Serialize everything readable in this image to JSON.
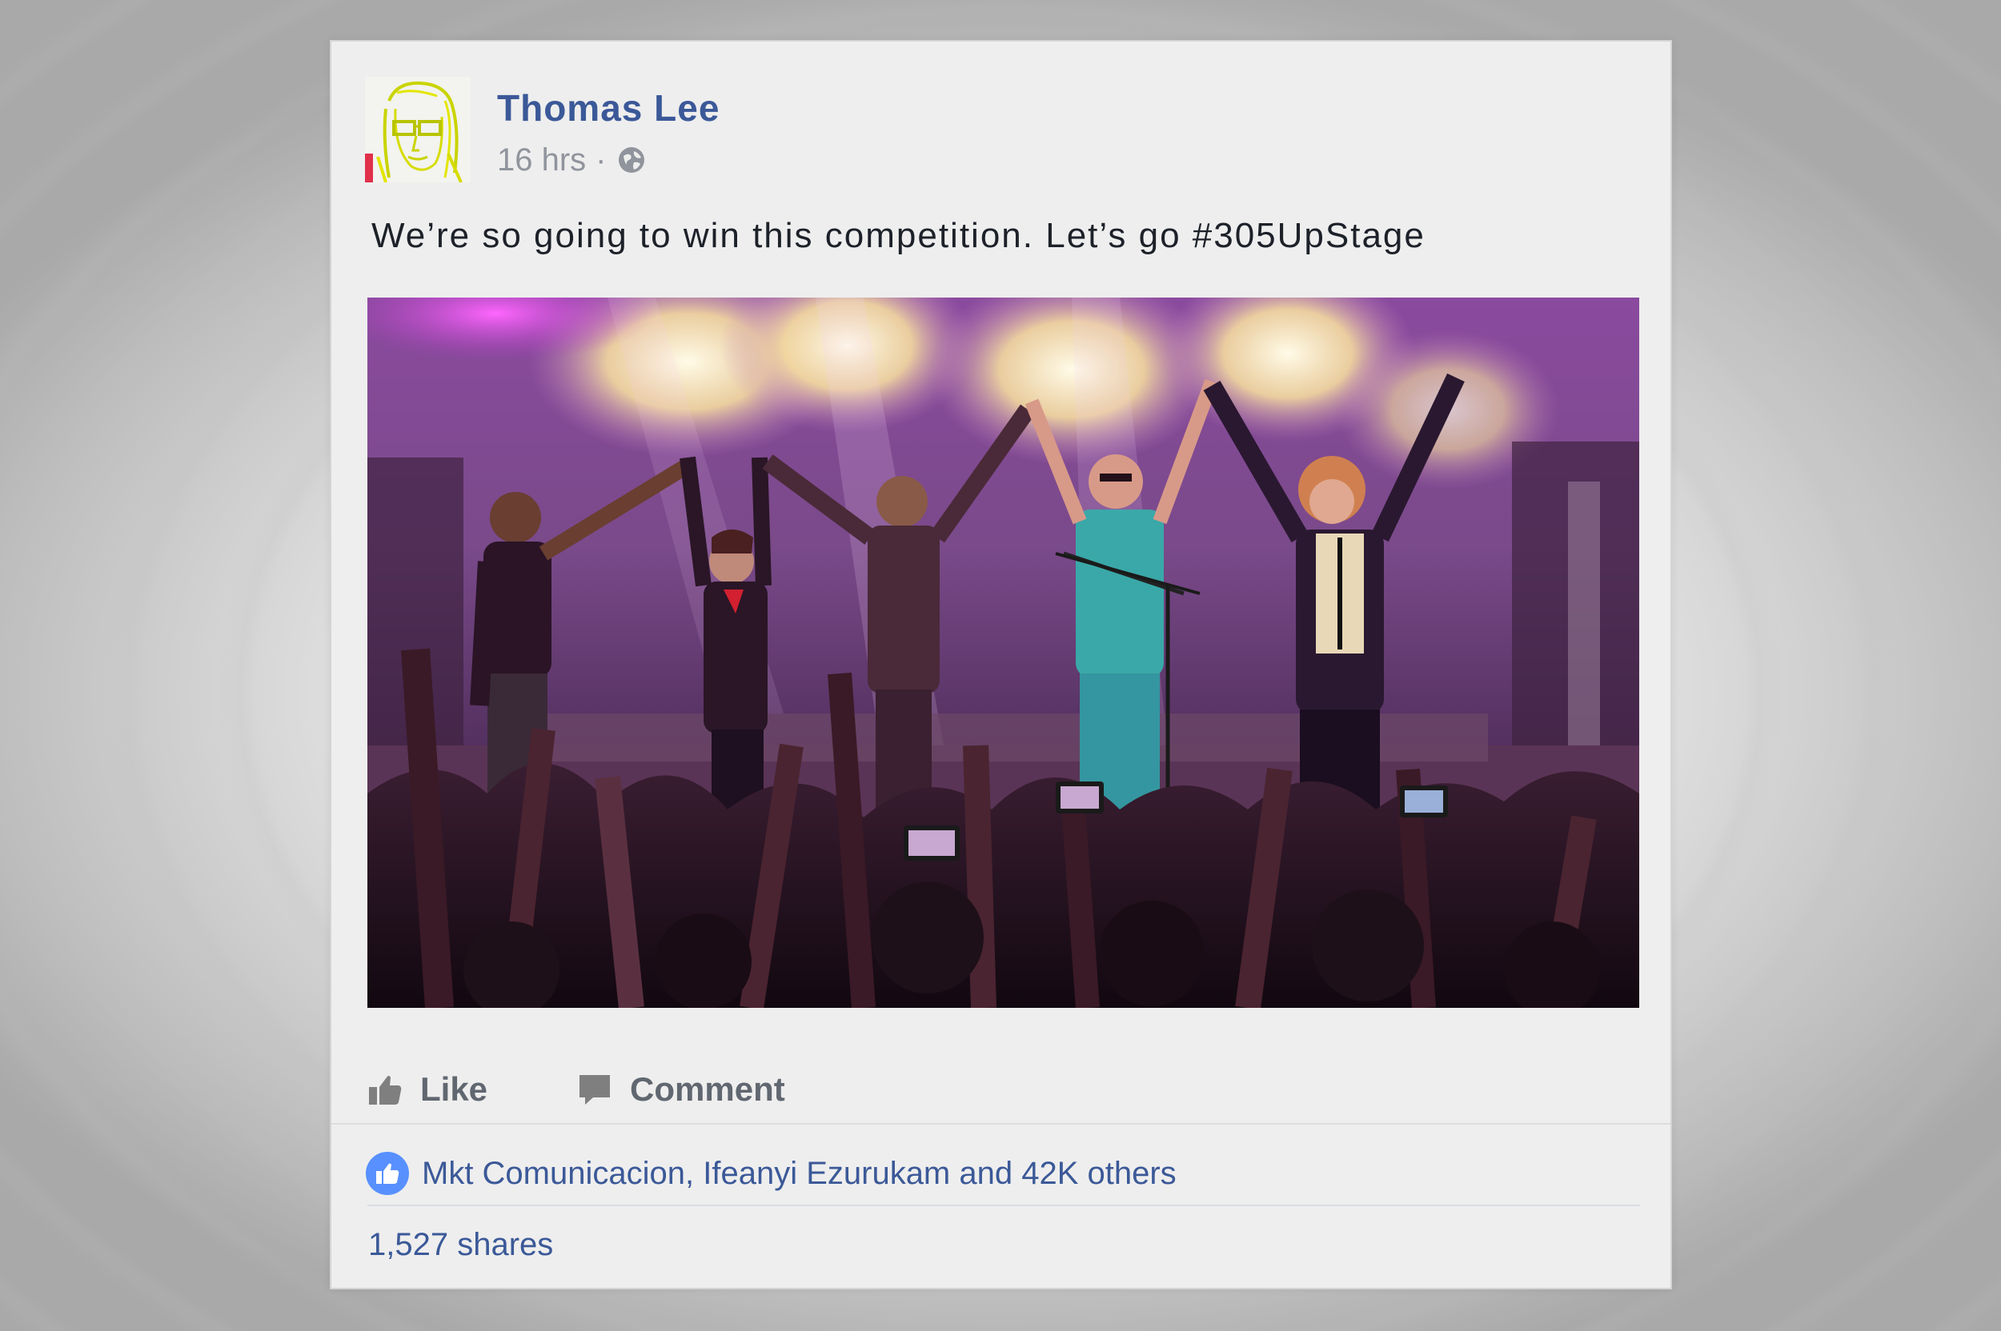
{
  "post": {
    "author": "Thomas Lee",
    "timestamp": "16 hrs",
    "separator": "·",
    "privacy_icon": "globe-icon",
    "text": "We’re so going to win this competition. Let’s go #305UpStage",
    "photo_icon": "concert-stage-photo"
  },
  "actions": {
    "like_label": "Like",
    "comment_label": "Comment"
  },
  "reactions": {
    "text": "Mkt Comunicacion, Ifeanyi Ezurukam and 42K others"
  },
  "shares": {
    "text": "1,527 shares"
  },
  "colors": {
    "link_blue": "#3b5998",
    "like_badge": "#5890ff",
    "card_bg": "#eeeeee",
    "muted_text": "#90949c"
  }
}
